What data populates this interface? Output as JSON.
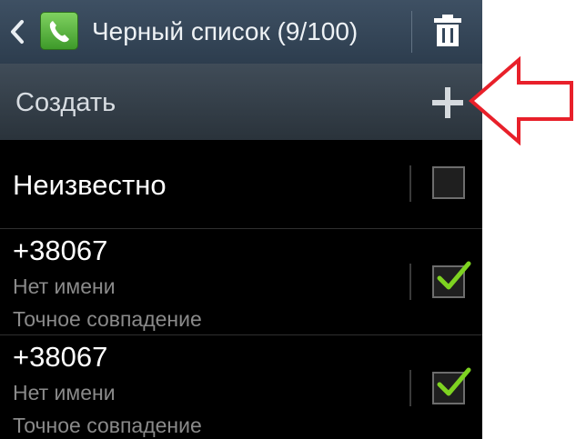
{
  "header": {
    "title": "Черный список (9/100)",
    "back_icon": "chevron-left-icon",
    "app_icon": "phone-app-icon",
    "delete_icon": "trash-icon"
  },
  "create": {
    "label": "Создать",
    "icon": "plus-icon"
  },
  "list": [
    {
      "title": "Неизвестно",
      "checked": false
    },
    {
      "title": "+38067",
      "subtitle": "Нет имени",
      "match": "Точное совпадение",
      "checked": true
    },
    {
      "title": "+38067",
      "subtitle": "Нет имени",
      "match": "Точное совпадение",
      "checked": true
    }
  ],
  "annotation": {
    "icon": "red-arrow-left-icon",
    "color": "#e8202a"
  },
  "colors": {
    "checkmark": "#7ed321",
    "actionbar": "#34465a",
    "background": "#000000"
  }
}
